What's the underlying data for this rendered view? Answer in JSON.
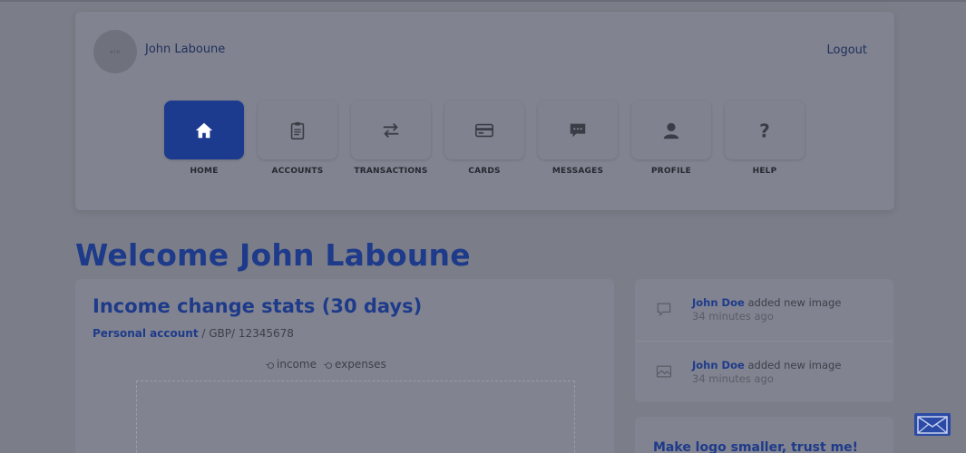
{
  "header": {
    "avatar_text": "ele",
    "user_name": "John Laboune",
    "logout_label": "Logout"
  },
  "nav": {
    "items": [
      {
        "label": "HOME",
        "icon": "home-icon",
        "active": true
      },
      {
        "label": "ACCOUNTS",
        "icon": "clipboard-icon",
        "active": false
      },
      {
        "label": "TRANSACTIONS",
        "icon": "transfer-arrows-icon",
        "active": false
      },
      {
        "label": "CARDS",
        "icon": "credit-card-icon",
        "active": false
      },
      {
        "label": "MESSAGES",
        "icon": "chat-bubble-icon",
        "active": false
      },
      {
        "label": "PROFILE",
        "icon": "user-icon",
        "active": false
      },
      {
        "label": "HELP",
        "icon": "question-mark-icon",
        "active": false
      }
    ]
  },
  "welcome": "Welcome John Laboune",
  "stats": {
    "title": "Income change stats (30 days)",
    "account_label": "Personal account",
    "account_meta": " / GBP/ 12345678",
    "legend": {
      "income": "income",
      "expenses": "expenses"
    }
  },
  "activity": {
    "items": [
      {
        "user": "John Doe",
        "action": " added new image",
        "time": "34 minutes ago",
        "icon": "comment-icon"
      },
      {
        "user": "John Doe",
        "action": " added new image",
        "time": "34 minutes ago",
        "icon": "image-icon"
      }
    ]
  },
  "note": {
    "title": "Make logo smaller, trust me!"
  },
  "colors": {
    "accent": "#1e3a8a",
    "overlay_background": "#7b7e88"
  }
}
